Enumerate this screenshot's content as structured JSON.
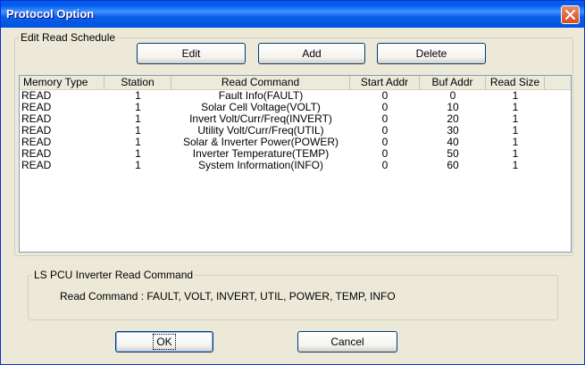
{
  "window": {
    "title": "Protocol Option"
  },
  "schedule": {
    "legend": "Edit Read Schedule",
    "buttons": {
      "edit": "Edit",
      "add": "Add",
      "delete": "Delete"
    },
    "columns": [
      "Memory Type",
      "Station",
      "Read Command",
      "Start Addr",
      "Buf Addr",
      "Read Size"
    ],
    "rows": [
      [
        "READ",
        "1",
        "Fault Info(FAULT)",
        "0",
        "0",
        "1"
      ],
      [
        "READ",
        "1",
        "Solar Cell Voltage(VOLT)",
        "0",
        "10",
        "1"
      ],
      [
        "READ",
        "1",
        "Invert Volt/Curr/Freq(INVERT)",
        "0",
        "20",
        "1"
      ],
      [
        "READ",
        "1",
        "Utility Volt/Curr/Freq(UTIL)",
        "0",
        "30",
        "1"
      ],
      [
        "READ",
        "1",
        "Solar & Inverter Power(POWER)",
        "0",
        "40",
        "1"
      ],
      [
        "READ",
        "1",
        "Inverter Temperature(TEMP)",
        "0",
        "50",
        "1"
      ],
      [
        "READ",
        "1",
        "System Information(INFO)",
        "0",
        "60",
        "1"
      ]
    ]
  },
  "command_group": {
    "legend": "LS PCU Inverter Read Command",
    "text": "Read Command : FAULT, VOLT, INVERT, UTIL, POWER, TEMP, INFO"
  },
  "footer": {
    "ok": "OK",
    "cancel": "Cancel"
  }
}
